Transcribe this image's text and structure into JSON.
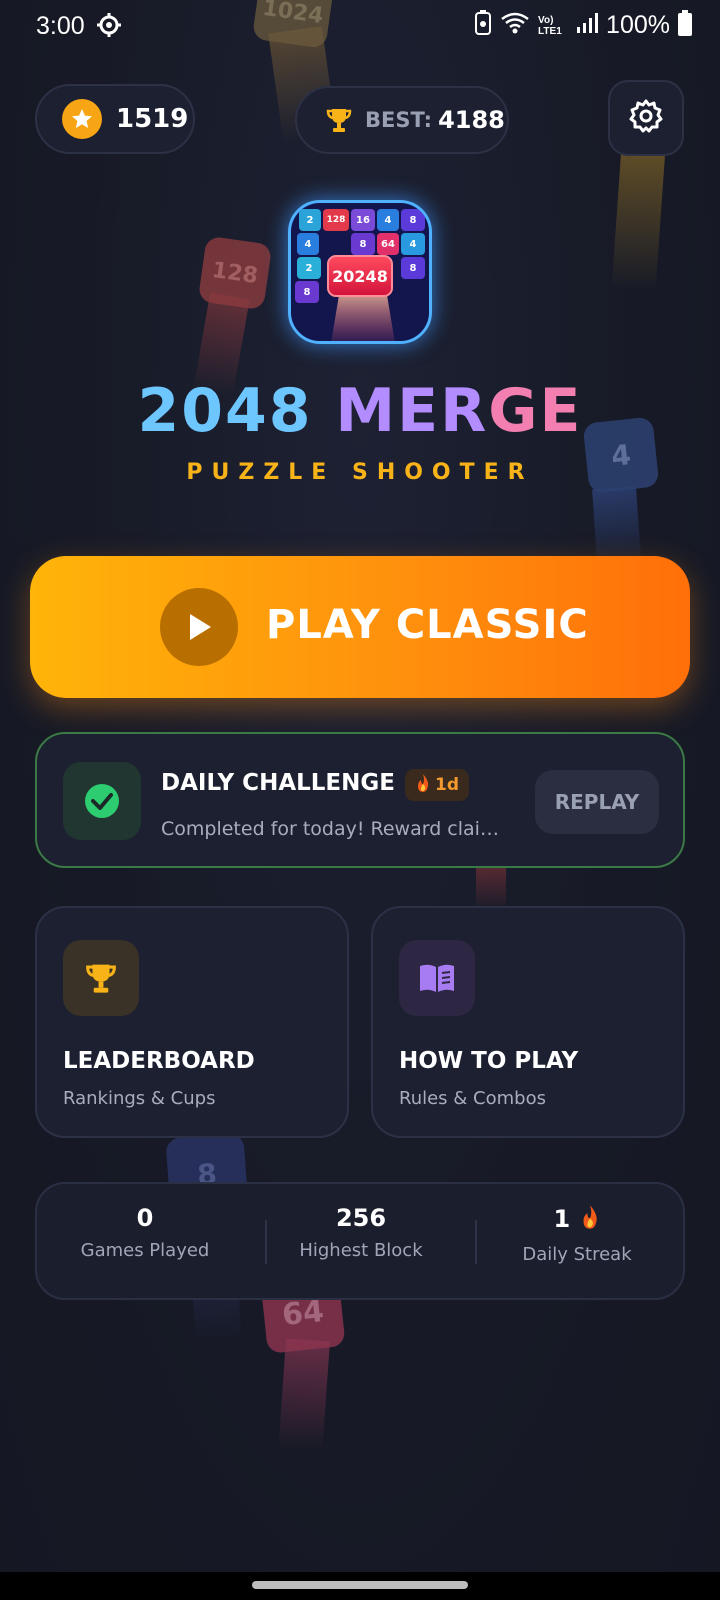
{
  "status_bar": {
    "time": "3:00",
    "battery_text": "100%",
    "network_label": "Vo) LTE1"
  },
  "header": {
    "coins": "1519",
    "best_label": "BEST:",
    "best_value": "4188"
  },
  "logo": {
    "tiles": [
      "2",
      "128",
      "16",
      "4",
      "8",
      "4",
      "8",
      "64",
      "4",
      "2",
      "8",
      "8"
    ],
    "big_tile": "20248"
  },
  "title": {
    "part1": "2048",
    "part2": "MER",
    "part3": "GE",
    "subtitle": "PUZZLE SHOOTER"
  },
  "play_button": {
    "label": "PLAY CLASSIC"
  },
  "daily_challenge": {
    "title": "DAILY CHALLENGE",
    "streak": "1d",
    "subtitle": "Completed for today! Reward claimed",
    "replay_label": "REPLAY"
  },
  "features": [
    {
      "title": "LEADERBOARD",
      "subtitle": "Rankings & Cups"
    },
    {
      "title": "HOW TO PLAY",
      "subtitle": "Rules & Combos"
    }
  ],
  "stats": [
    {
      "value": "0",
      "label": "Games Played"
    },
    {
      "value": "256",
      "label": "Highest Block"
    },
    {
      "value": "1",
      "label": "Daily Streak"
    }
  ],
  "background_blocks": [
    "1024",
    "128",
    "4",
    "8",
    "64"
  ],
  "colors": {
    "accent_orange": "#ff8e0d",
    "gold": "#f7b318",
    "success_green": "#3a7a45",
    "background": "#171a26"
  }
}
